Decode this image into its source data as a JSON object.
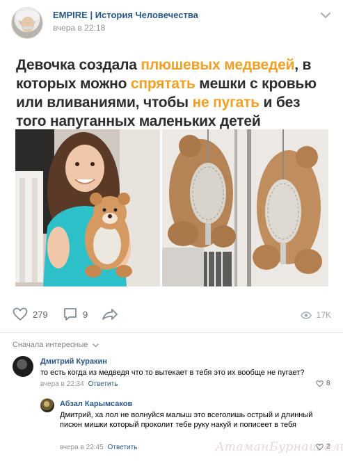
{
  "post": {
    "group_name": "EMPIRE | История Человечества",
    "time": "вчера в 22:18",
    "avatar_icon": "group-avatar-einstein",
    "menu_icon": "chevron-down-icon"
  },
  "headline": {
    "parts": [
      {
        "text": "Девочка создала ",
        "highlight": false
      },
      {
        "text": "плюшевых медведей",
        "highlight": true
      },
      {
        "text": ", в которых можно ",
        "highlight": false
      },
      {
        "text": "спрятать",
        "highlight": true
      },
      {
        "text": " мешки с кровью или вливаниями, чтобы ",
        "highlight": false
      },
      {
        "text": "не пугать",
        "highlight": true
      },
      {
        "text": " и без того напуганных маленьких детей",
        "highlight": false
      }
    ],
    "accent_color": "#f0a025"
  },
  "actions": {
    "likes": "279",
    "comments": "9",
    "views": "17K",
    "like_icon": "heart-icon",
    "comment_icon": "comment-icon",
    "share_icon": "share-arrow-icon",
    "views_icon": "eye-icon"
  },
  "comments": {
    "sort_label": "Сначала интересные",
    "items": [
      {
        "author": "Дмитрий Куракин",
        "text": "то есть когда из медведя что то вытекает в тебя это их вообще не пугает?",
        "time": "вчера в 22:34",
        "reply_label": "Ответить",
        "likes": "8"
      },
      {
        "author": "Абзал Карымсаков",
        "text": "Дмитрий, ха лол не волнуйся малыш это всеголишь острый и длинный писюн мишки который проколит тебе руку накуй и пописеет в тебя",
        "time": "вчера в 22:45",
        "reply_label": "Ответить",
        "likes": "2"
      }
    ]
  },
  "watermark": "AтаманБурнаш али?!",
  "colors": {
    "link": "#2a5885",
    "meta": "#939393",
    "divider": "#e7e8ec"
  }
}
